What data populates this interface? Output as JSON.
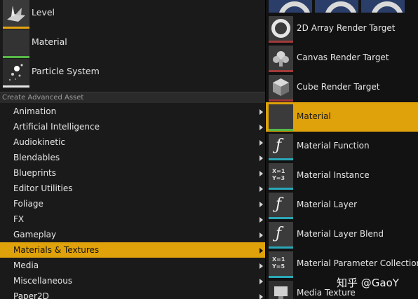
{
  "top_items": [
    {
      "label": "Level",
      "icon": "level-icon",
      "bar_color": "#e6a40f"
    },
    {
      "label": "Material",
      "icon": "material-icon",
      "bar_color": "#57b947"
    },
    {
      "label": "Particle System",
      "icon": "particle-system-icon",
      "bar_color": "#e6e6e6"
    }
  ],
  "advanced_header": "Create Advanced Asset",
  "categories": [
    {
      "label": "Animation"
    },
    {
      "label": "Artificial Intelligence"
    },
    {
      "label": "Audiokinetic"
    },
    {
      "label": "Blendables"
    },
    {
      "label": "Blueprints"
    },
    {
      "label": "Editor Utilities"
    },
    {
      "label": "Foliage"
    },
    {
      "label": "FX"
    },
    {
      "label": "Gameplay"
    },
    {
      "label": "Materials & Textures"
    },
    {
      "label": "Media"
    },
    {
      "label": "Miscellaneous"
    },
    {
      "label": "Paper2D"
    }
  ],
  "selected_category": "Materials & Textures",
  "submenu": [
    {
      "label": "2D Array Render Target",
      "icon": "render-target-icon",
      "bar_color": "#a23a3a"
    },
    {
      "label": "Canvas Render Target",
      "icon": "canvas-render-target-icon",
      "bar_color": "#a23a3a"
    },
    {
      "label": "Cube Render Target",
      "icon": "cube-render-target-icon",
      "bar_color": "#a23a3a"
    },
    {
      "label": "Material",
      "icon": "material-icon",
      "bar_color": "#57b947"
    },
    {
      "label": "Material Function",
      "icon": "function-icon",
      "bar_color": "#2aa8b8"
    },
    {
      "label": "Material Instance",
      "icon": "material-instance-icon",
      "bar_color": "#2aa8b8"
    },
    {
      "label": "Material Layer",
      "icon": "function-icon",
      "bar_color": "#2aa8b8"
    },
    {
      "label": "Material Layer Blend",
      "icon": "function-icon",
      "bar_color": "#2aa8b8"
    },
    {
      "label": "Material Parameter Collection",
      "icon": "parameter-collection-icon",
      "bar_color": "#2aa8b8"
    },
    {
      "label": "Media Texture",
      "icon": "media-texture-icon",
      "bar_color": "#a23a3a"
    }
  ],
  "selected_submenu": "Material",
  "instance_icon_text": {
    "line1": "X=1",
    "line2": "Y=3"
  },
  "param_icon_text": {
    "line1": "X=1",
    "line2": "Y=5"
  },
  "watermark": "知乎 @GaoY",
  "accent_color": "#e0a20a"
}
